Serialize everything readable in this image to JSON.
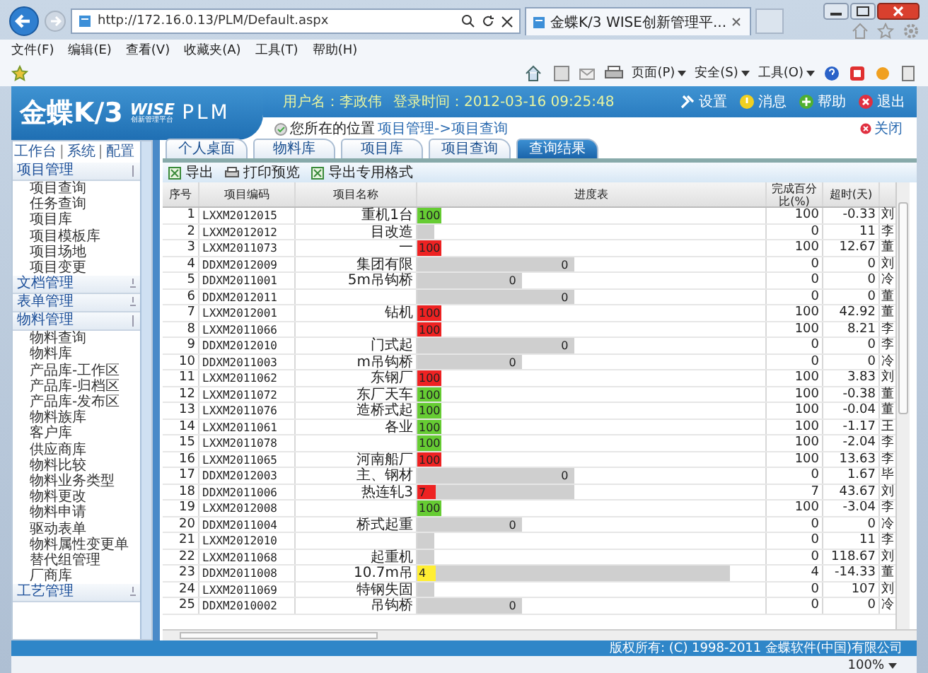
{
  "browser": {
    "url": "http://172.16.0.13/PLM/Default.aspx",
    "tab": "金蝶K/3 WISE创新管理平...",
    "menu": [
      "文件(F)",
      "编辑(E)",
      "查看(V)",
      "收藏夹(A)",
      "工具(T)",
      "帮助(H)"
    ],
    "commands": [
      "页面(P)",
      "安全(S)",
      "工具(O)"
    ]
  },
  "header": {
    "logo": "金蝶K/3",
    "logo_mark": "WISE",
    "logo_sub": "创新管理平台",
    "product": "PLM",
    "user": "用户名：李政伟",
    "login": "登录时间：2012-03-16 09:25:48",
    "links": [
      {
        "kind": "settings",
        "label": "设置"
      },
      {
        "kind": "message",
        "label": "消息"
      },
      {
        "kind": "help",
        "label": "帮助"
      },
      {
        "kind": "exit",
        "label": "退出"
      }
    ]
  },
  "breadcrumb": {
    "prefix": "您所在的位置",
    "path": "项目管理->项目查询",
    "close": "关闭"
  },
  "sidebar": {
    "top_links": [
      "工作台",
      "系统",
      "配置"
    ],
    "separator": "|",
    "groups": [
      {
        "label": "项目管理",
        "expanded": true,
        "items": [
          "项目查询",
          "任务查询",
          "项目库",
          "项目模板库",
          "项目场地",
          "项目变更"
        ]
      },
      {
        "label": "文档管理",
        "expanded": false
      },
      {
        "label": "表单管理",
        "expanded": false
      },
      {
        "label": "物料管理",
        "expanded": true,
        "items": [
          "物料查询",
          "物料库",
          "产品库-工作区",
          "产品库-归档区",
          "产品库-发布区",
          "物料族库",
          "客户库",
          "供应商库",
          "物料比较",
          "物料业务类型",
          "物料更改",
          "物料申请",
          "驱动表单",
          "物料属性变更单",
          "替代组管理",
          "厂商库"
        ]
      },
      {
        "label": "工艺管理",
        "expanded": false
      }
    ]
  },
  "tabs": [
    {
      "label": "个人桌面",
      "selected": false
    },
    {
      "label": "物料库",
      "selected": false
    },
    {
      "label": "项目库",
      "selected": false
    },
    {
      "label": "项目查询",
      "selected": false
    },
    {
      "label": "查询结果",
      "selected": true
    }
  ],
  "toolbar": [
    {
      "kind": "export",
      "label": "导出"
    },
    {
      "kind": "print",
      "label": "打印预览"
    },
    {
      "kind": "export",
      "label": "导出专用格式"
    }
  ],
  "table": {
    "columns": [
      "序号",
      "项目编码",
      "项目名称",
      "进度表",
      "完成百分比(%)",
      "超时(天)"
    ],
    "rows": [
      {
        "no": "1",
        "code": "LXXM2012015",
        "name": "重机1台",
        "mark": {
          "color": "#66cc33",
          "label": "100"
        },
        "pct": "100",
        "overdue": "-0.33",
        "column_7": "刘"
      },
      {
        "no": "2",
        "code": "LXXM2012012",
        "name": "目改造",
        "bar": {
          "level": 0.05
        },
        "pct": "0",
        "overdue": "11",
        "column_7": "李"
      },
      {
        "no": "3",
        "code": "LXXM2011073",
        "name": "一",
        "mark": {
          "color": "#ee2222",
          "label": "100"
        },
        "pct": "100",
        "overdue": "12.67",
        "column_7": "董"
      },
      {
        "no": "4",
        "code": "DDXM2012009",
        "name": "集团有限",
        "bar": {
          "level": 0.45,
          "label": "0"
        },
        "pct": "0",
        "overdue": "0",
        "column_7": "刘"
      },
      {
        "no": "5",
        "code": "DDXM2011001",
        "name": "5m吊钩桥",
        "bar": {
          "level": 0.3,
          "label": "0"
        },
        "pct": "0",
        "overdue": "0",
        "column_7": "冷"
      },
      {
        "no": "6",
        "code": "DDXM2012011",
        "name": "",
        "bar": {
          "level": 0.45,
          "label": "0"
        },
        "pct": "0",
        "overdue": "0",
        "column_7": "董"
      },
      {
        "no": "7",
        "code": "LXXM2012001",
        "name": "钻机",
        "mark": {
          "color": "#ee2222",
          "label": "100"
        },
        "pct": "100",
        "overdue": "42.92",
        "column_7": "董"
      },
      {
        "no": "8",
        "code": "LXXM2011066",
        "name": "",
        "mark": {
          "color": "#ee2222",
          "label": "100"
        },
        "pct": "100",
        "overdue": "8.21",
        "column_7": "李"
      },
      {
        "no": "9",
        "code": "DDXM2012010",
        "name": "门式起",
        "bar": {
          "level": 0.45,
          "label": "0"
        },
        "pct": "0",
        "overdue": "0",
        "column_7": "李"
      },
      {
        "no": "10",
        "code": "DDXM2011003",
        "name": "m吊钩桥",
        "bar": {
          "level": 0.3,
          "label": "0"
        },
        "pct": "0",
        "overdue": "0",
        "column_7": "冷"
      },
      {
        "no": "11",
        "code": "LXXM2011062",
        "name": "东钢厂",
        "mark": {
          "color": "#ee2222",
          "label": "100"
        },
        "pct": "100",
        "overdue": "3.83",
        "column_7": "刘"
      },
      {
        "no": "12",
        "code": "LXXM2011072",
        "name": "东厂天车",
        "mark": {
          "color": "#66cc33",
          "label": "100"
        },
        "pct": "100",
        "overdue": "-0.38",
        "column_7": "董"
      },
      {
        "no": "13",
        "code": "LXXM2011076",
        "name": "造桥式起",
        "mark": {
          "color": "#66cc33",
          "label": "100"
        },
        "pct": "100",
        "overdue": "-0.04",
        "column_7": "董"
      },
      {
        "no": "14",
        "code": "LXXM2011061",
        "name": "各业",
        "mark": {
          "color": "#66cc33",
          "label": "100"
        },
        "pct": "100",
        "overdue": "-1.17",
        "column_7": "王"
      },
      {
        "no": "15",
        "code": "LXXM2011078",
        "name": "",
        "mark": {
          "color": "#66cc33",
          "label": "100"
        },
        "pct": "100",
        "overdue": "-2.04",
        "column_7": "李"
      },
      {
        "no": "16",
        "code": "LXXM2011065",
        "name": "河南船厂",
        "mark": {
          "color": "#ee2222",
          "label": "100"
        },
        "pct": "100",
        "overdue": "13.63",
        "column_7": "李"
      },
      {
        "no": "17",
        "code": "DDXM2012003",
        "name": "主、钢材",
        "bar": {
          "level": 0.45,
          "label": "0"
        },
        "pct": "0",
        "overdue": "1.67",
        "column_7": "毕"
      },
      {
        "no": "18",
        "code": "DDXM2011006",
        "name": "热连轧3",
        "mark": {
          "color": "#ee2222",
          "label": "7"
        },
        "bar": {
          "level": 0.45
        },
        "pct": "7",
        "overdue": "43.67",
        "column_7": "刘"
      },
      {
        "no": "19",
        "code": "LXXM2012008",
        "name": "",
        "mark": {
          "color": "#66cc33",
          "label": "100"
        },
        "pct": "100",
        "overdue": "-3.04",
        "column_7": "李"
      },
      {
        "no": "20",
        "code": "DDXM2011004",
        "name": "桥式起重",
        "bar": {
          "level": 0.3,
          "label": "0"
        },
        "pct": "0",
        "overdue": "0",
        "column_7": "冷"
      },
      {
        "no": "21",
        "code": "LXXM2012010",
        "name": "",
        "bar": {
          "level": 0.05
        },
        "pct": "0",
        "overdue": "11",
        "column_7": "李"
      },
      {
        "no": "22",
        "code": "LXXM2011068",
        "name": "起重机",
        "bar": {
          "level": 0.05
        },
        "pct": "0",
        "overdue": "118.67",
        "column_7": "刘"
      },
      {
        "no": "23",
        "code": "DDXM2011008",
        "name": "10.7m吊",
        "mark": {
          "color": "#ffee33",
          "label": "4"
        },
        "bar": {
          "level": 0.9
        },
        "pct": "4",
        "overdue": "-14.33",
        "column_7": "董"
      },
      {
        "no": "24",
        "code": "LXXM2011069",
        "name": "特钢失固",
        "bar": {
          "level": 0.05
        },
        "pct": "0",
        "overdue": "107",
        "column_7": "刘"
      },
      {
        "no": "25",
        "code": "DDXM2010002",
        "name": "吊钩桥",
        "bar": {
          "level": 0.3,
          "label": "0"
        },
        "pct": "0",
        "overdue": "0",
        "column_7": "冷"
      }
    ]
  },
  "footer": "版权所有: (C) 1998-2011 金蝶软件(中国)有限公司",
  "status": {
    "zoom": "100%"
  }
}
